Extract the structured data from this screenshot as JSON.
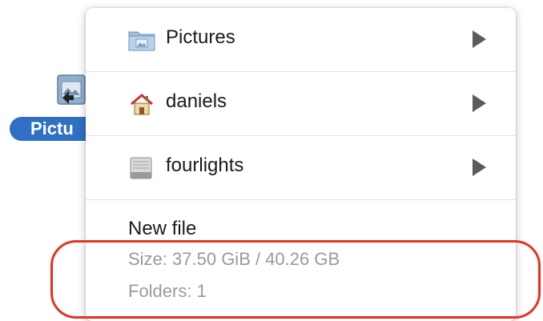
{
  "desktop": {
    "item_label": "Pictu",
    "icon": "pictures-folder-icon"
  },
  "menu": {
    "items": [
      {
        "label": "Pictures",
        "icon": "pictures-folder-icon",
        "submenu_icon": "submenu-arrow-icon"
      },
      {
        "label": "daniels",
        "icon": "home-icon",
        "submenu_icon": "submenu-arrow-icon"
      },
      {
        "label": "fourlights",
        "icon": "hard-drive-icon",
        "submenu_icon": "submenu-arrow-icon"
      }
    ],
    "info": {
      "title": "New file",
      "size": "Size: 37.50 GiB / 40.26 GB",
      "folders": "Folders: 1"
    }
  },
  "colors": {
    "selection_blue": "#2f6fc4",
    "highlight_red": "#e53321",
    "secondary_text": "#9a9a9a"
  }
}
